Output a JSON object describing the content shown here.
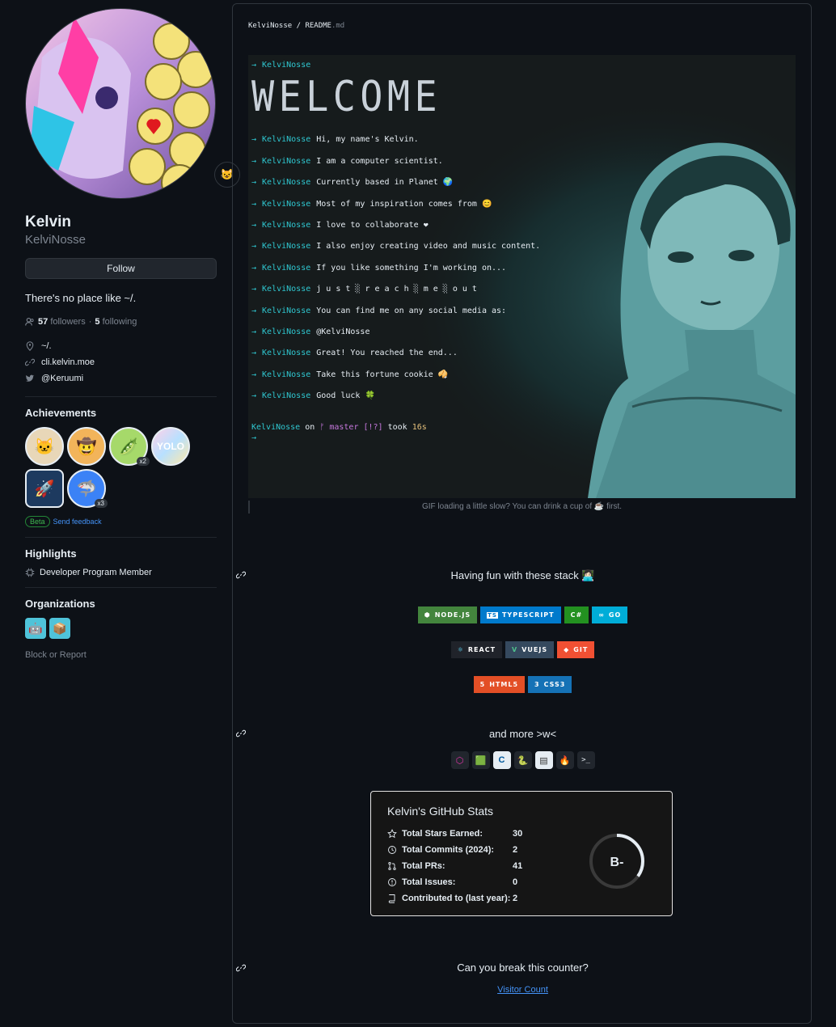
{
  "profile": {
    "name": "Kelvin",
    "login": "KelviNosse",
    "follow_label": "Follow",
    "bio": "There's no place like ~/.",
    "followers_count": "57",
    "followers_label": "followers",
    "following_count": "5",
    "following_label": "following",
    "location": "~/.",
    "website": "cli.kelvin.moe",
    "twitter": "@Keruumi"
  },
  "achievements": {
    "title": "Achievements",
    "badges": [
      {
        "icon": "🐱",
        "mult": ""
      },
      {
        "icon": "🤠",
        "mult": ""
      },
      {
        "icon": "🫛",
        "mult": "x2"
      },
      {
        "icon": "YOLO",
        "mult": ""
      },
      {
        "icon": "🚀",
        "mult": ""
      },
      {
        "icon": "🦈",
        "mult": "x3"
      }
    ],
    "beta_label": "Beta",
    "feedback_label": "Send feedback"
  },
  "highlights": {
    "title": "Highlights",
    "item": "Developer Program Member"
  },
  "organizations": {
    "title": "Organizations",
    "block_label": "Block or Report"
  },
  "readme": {
    "crumb_user": "KelviNosse",
    "crumb_sep": " / ",
    "crumb_file": "README",
    "crumb_ext": ".md",
    "welcome": "WELCOME",
    "terminal_user": "KelviNosse",
    "terminal_lines": [
      "",
      "",
      "",
      "Hi, my name's Kelvin.",
      "I am a computer scientist.",
      "Currently based in Planet 🌍",
      "Most of my inspiration comes from 😊",
      "I love to collaborate ❤",
      "I also enjoy creating video and music content.",
      "If you like something I'm working on...",
      "j u s t ░ r e a c h ░ m e ░ o u t",
      "You can find me on any social media as:",
      "@KelviNosse",
      "Great! You reached the end...",
      "Take this fortune cookie 🥠",
      "Good luck 🍀"
    ],
    "prompt_on": "on",
    "prompt_branch": " master [!?]",
    "prompt_took": "took",
    "prompt_time": "16s",
    "caption": "GIF loading a little slow? You can drink a cup of ☕ first.",
    "stack_heading": "Having fun with these stack 👩🏻‍💻",
    "stack_row1": [
      {
        "label": "NODE.JS",
        "color": "#43853d",
        "icon": "⬢"
      },
      {
        "label": "TYPESCRIPT",
        "color": "#007acc",
        "icon": "TS"
      },
      {
        "label": "C#",
        "color": "#239120",
        "icon": ""
      },
      {
        "label": "GO",
        "color": "#00add8",
        "icon": "∞"
      }
    ],
    "stack_row2": [
      {
        "label": "REACT",
        "color": "#20232a",
        "icon": "⚛"
      },
      {
        "label": "VUEJS",
        "color": "#35495e",
        "icon": "V"
      },
      {
        "label": "GIT",
        "color": "#f05033",
        "icon": "◆"
      }
    ],
    "stack_row3": [
      {
        "label": "HTML5",
        "color": "#e34f26",
        "icon": "5"
      },
      {
        "label": "CSS3",
        "color": "#1572b6",
        "icon": "3"
      }
    ],
    "more_heading": "and more >w<",
    "tools": [
      "⬡",
      "🟩",
      "C",
      "🐍",
      "▤",
      "🔥",
      ">_"
    ],
    "stats_title": "Kelvin's GitHub Stats",
    "stats": [
      {
        "label": "Total Stars Earned:",
        "value": "30"
      },
      {
        "label": "Total Commits (2024):",
        "value": "2"
      },
      {
        "label": "Total PRs:",
        "value": "41"
      },
      {
        "label": "Total Issues:",
        "value": "0"
      },
      {
        "label": "Contributed to (last year):",
        "value": "2"
      }
    ],
    "rank": "B-",
    "counter_heading": "Can you break this counter?",
    "counter_alt": "Visitor Count"
  },
  "colors": {
    "accent": "#2fc7d0",
    "link": "#4493f8",
    "bg": "#0d1117"
  }
}
